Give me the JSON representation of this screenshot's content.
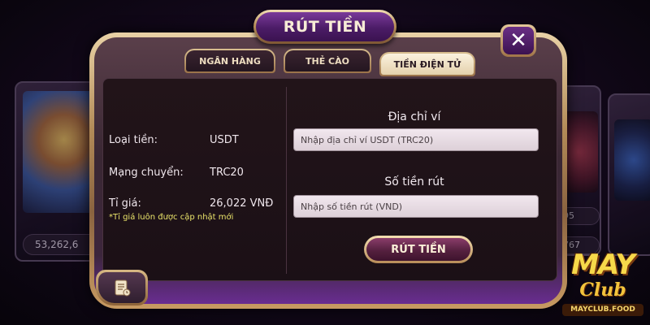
{
  "background": {
    "left_tile_count": "53,262,6",
    "right_tile_counts": [
      "95",
      "767"
    ]
  },
  "dialog": {
    "title": "RÚT TIỀN",
    "close_glyph": "✕",
    "tabs": [
      {
        "label": "NGÂN HÀNG",
        "active": false
      },
      {
        "label": "THẺ CÀO",
        "active": false
      },
      {
        "label": "TIỀN ĐIỆN TỬ",
        "active": true
      }
    ]
  },
  "info": {
    "currency_label": "Loại tiền:",
    "currency_value": "USDT",
    "network_label": "Mạng chuyển:",
    "network_value": "TRC20",
    "rate_label": "Tỉ giá:",
    "rate_value": "26,022 VNĐ",
    "rate_note": "*Tỉ giá luôn được cập nhật mới"
  },
  "form": {
    "wallet_title": "Địa chỉ ví",
    "wallet_placeholder": "Nhập địa chỉ ví USDT (TRC20)",
    "wallet_value": "",
    "amount_title": "Số tiền rút",
    "amount_placeholder": "Nhập số tiền rút (VND)",
    "amount_value": "",
    "submit_label": "RÚT TIỀN"
  },
  "logo": {
    "main": "MAY",
    "sub": "Club",
    "domain": "MAYCLUB.FOOD"
  },
  "icons": {
    "close": "close-icon",
    "history": "scroll-icon"
  },
  "colors": {
    "frame_gold": "#b38b58",
    "title_purple": "#4b1c66",
    "note_yellow": "#e9e36a",
    "active_tab": "#fbf2df"
  }
}
